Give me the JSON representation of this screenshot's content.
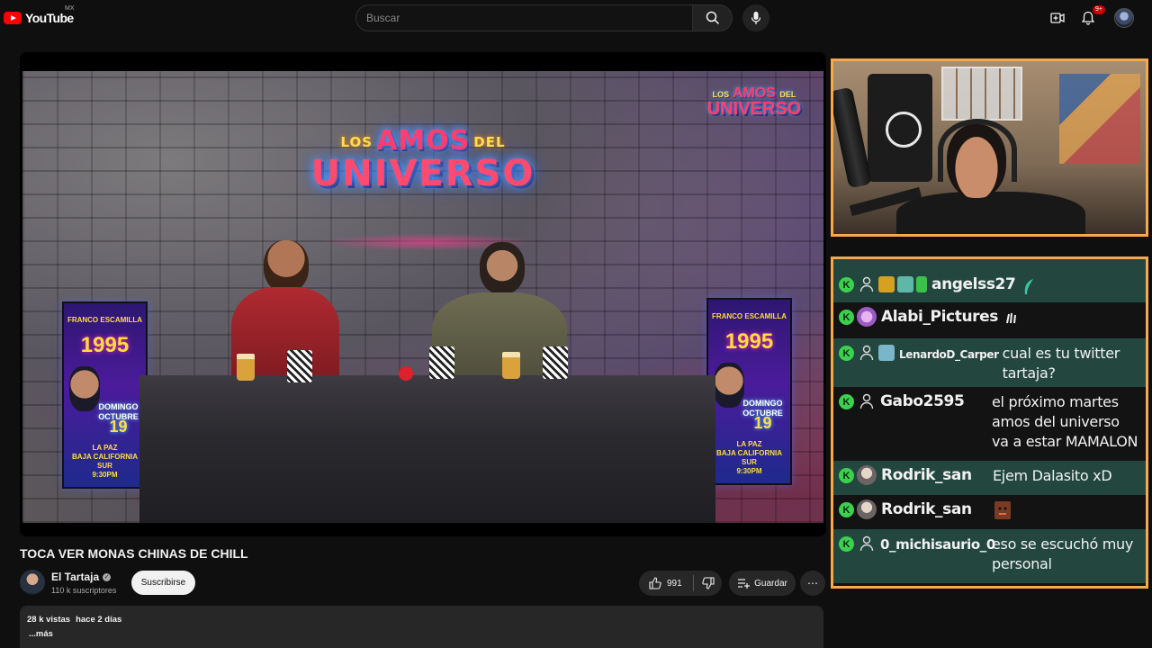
{
  "header": {
    "logo_text": "YouTube",
    "logo_region": "MX",
    "search_placeholder": "Buscar",
    "notifications_badge": "9+"
  },
  "video": {
    "title": "TOCA VER MONAS CHINAS DE CHILL",
    "sign_small_left": "LOS",
    "sign_top_word": "AMOS",
    "sign_small_right": "DEL",
    "sign_bottom_word": "UNIVERSO",
    "poster_header": "FRANCO ESCAMILLA",
    "poster_year": "1995",
    "poster_day": "DOMINGO",
    "poster_month": "OCTUBRE",
    "poster_date": "19",
    "poster_place": "LA PAZ",
    "poster_state": "BAJA CALIFORNIA SUR",
    "poster_time": "9:30PM"
  },
  "channel": {
    "name": "El Tartaja",
    "verified_mark": "✓",
    "subscribers": "110 k suscriptores",
    "subscribe_label": "Suscribirse"
  },
  "actions": {
    "like_count": "991",
    "save_label": "Guardar",
    "more_label": "⋯"
  },
  "description": {
    "views": "28 k vistas",
    "date": "hace 2 días",
    "more": "...más"
  },
  "chat": {
    "mod_glyph": "K",
    "messages": [
      {
        "user": "angelss27",
        "text": ""
      },
      {
        "user": "Alabi_Pictures",
        "text": ""
      },
      {
        "user": "LenardoD_Carper",
        "text": "cual es tu twitter tartaja?"
      },
      {
        "user": "Gabo2595",
        "text": "el próximo martes amos del universo va a estar MAMALON"
      },
      {
        "user": "Rodrik_san",
        "text": "Ejem Dalasito xD"
      },
      {
        "user": "Rodrik_san",
        "text": ""
      },
      {
        "user": "0_michisaurio_0",
        "text": "eso se escuchó muy personal"
      }
    ]
  },
  "colors": {
    "overlay_border": "#f4a94e",
    "chat_highlight": "#23473f",
    "mod_badge": "#3bd14e",
    "brand_red": "#ff0000"
  }
}
